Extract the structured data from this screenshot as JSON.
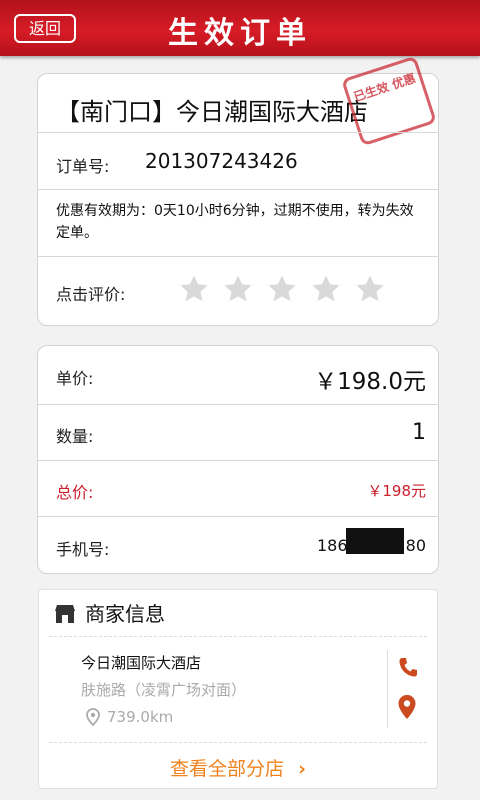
{
  "header": {
    "back_label": "返回",
    "title": "生效订单"
  },
  "order": {
    "hotel_name": "【南门口】今日潮国际大酒店",
    "stamp_text": "已生效 优惠",
    "order_no_label": "订单号:",
    "order_no": "201307243426",
    "validity_text": "优惠有效期为：0天10小时6分钟，过期不使用，转为失效定单。",
    "rating_label": "点击评价:"
  },
  "pricing": {
    "unit_price_label": "单价:",
    "unit_price": "￥198.0元",
    "quantity_label": "数量:",
    "quantity": "1",
    "total_label": "总价:",
    "total": "￥198元",
    "phone_label": "手机号:",
    "phone_prefix": "186",
    "phone_suffix": "80"
  },
  "merchant": {
    "section_title": "商家信息",
    "name": "今日潮国际大酒店",
    "address": "肤施路（凌霄广场对面）",
    "distance": "739.0km",
    "view_all_label": "查看全部分店",
    "view_all_arrow": "›"
  },
  "colors": {
    "brand_red": "#d71c26",
    "accent_orange": "#f0821e",
    "total_red": "#cc1f2c",
    "muted": "#aaaaaa"
  },
  "icons": [
    "shop-icon",
    "phone-icon",
    "map-pin-icon",
    "location-icon",
    "star-icon",
    "chevron-right-icon"
  ]
}
